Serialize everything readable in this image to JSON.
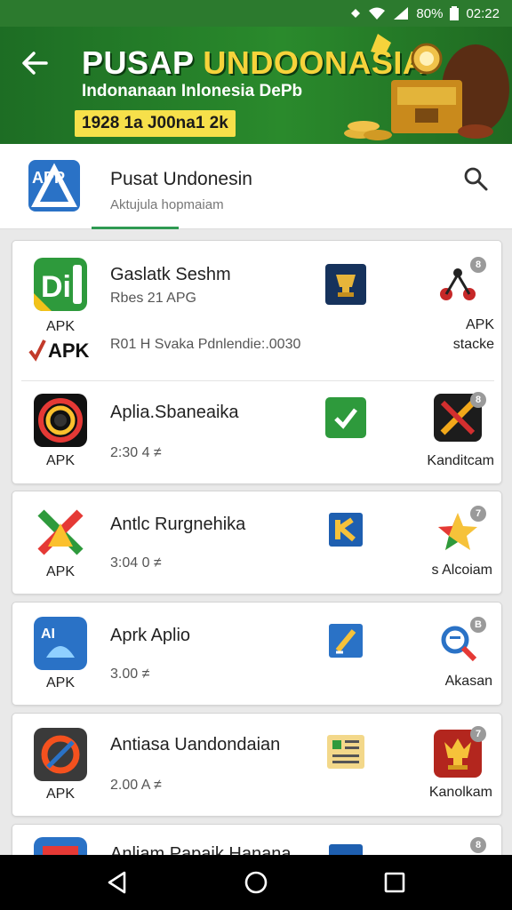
{
  "status": {
    "battery": "80%",
    "time": "02:22"
  },
  "banner": {
    "title_part1": "PUSAP ",
    "title_part2": "UNDOONASIA",
    "subtitle": "Indonanaan Inlonesia DePb",
    "code": "1928 1a J00na1 2k"
  },
  "header": {
    "logo_text": "APP",
    "title": "Pusat Undonesin",
    "subtitle": "Aktujula hopmaiam"
  },
  "apps": [
    {
      "icon_text": "Di",
      "apk": "APK",
      "name": "Gaslatk Seshm",
      "sub": "Rbes 21 APG",
      "meta": "R01 H Svaka Pdnlendie:.0030",
      "extra": "APK",
      "right_top": "APK",
      "right_label": "stacke",
      "badge": "8"
    },
    {
      "apk": "APK",
      "name": "Aplia.Sbaneaika",
      "meta": "2:30 4 ≠",
      "right_label": "Kanditcam",
      "badge": "8"
    },
    {
      "apk": "APK",
      "name": "Antlc Rurgnehika",
      "meta": "3:04 0 ≠",
      "right_label": "s Alcoiam",
      "badge": "7"
    },
    {
      "icon_text": "AI",
      "apk": "APK",
      "name": "Aprk Aplio",
      "meta": "3.00 ≠",
      "right_label": "Akasan",
      "badge": "B"
    },
    {
      "apk": "APK",
      "name": "Antiasa Uandondaian",
      "meta": "2.00 A ≠",
      "right_label": "Kanolkam",
      "badge": "7"
    },
    {
      "name": "Anliam Papaik Hanana",
      "badge": "8"
    }
  ],
  "colors": {
    "brand_green": "#2a8a2c",
    "accent_yellow": "#f6d33b",
    "tab_underline": "#2f9a52"
  }
}
